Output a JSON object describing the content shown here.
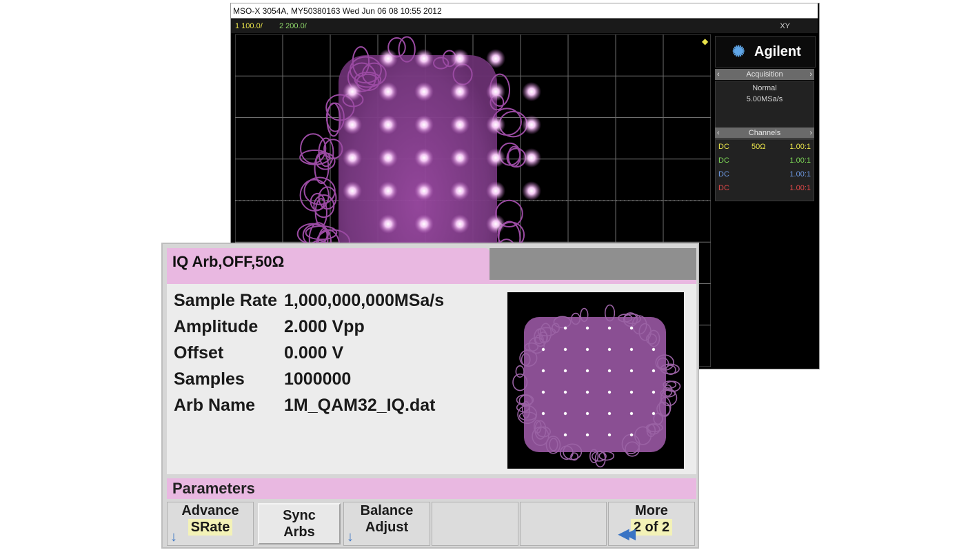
{
  "scope": {
    "title_bar": "MSO-X 3054A, MY50380163 Wed Jun 06 08 10:55 2012",
    "ch1_scale": "1  100.0/",
    "ch2_scale": "2  200.0/",
    "mode": "XY",
    "brand": "Agilent",
    "acquisition": {
      "header": "Acquisition",
      "mode": "Normal",
      "rate": "5.00MSa/s"
    },
    "channels": {
      "header": "Channels",
      "rows": [
        {
          "coupling": "DC",
          "impedance": "50Ω",
          "probe": "1.00:1",
          "color": "#e9e34a"
        },
        {
          "coupling": "DC",
          "impedance": "",
          "probe": "1.00:1",
          "color": "#7ed957"
        },
        {
          "coupling": "DC",
          "impedance": "",
          "probe": "1.00:1",
          "color": "#6f9be6"
        },
        {
          "coupling": "DC",
          "impedance": "",
          "probe": "1.00:1",
          "color": "#e04848"
        }
      ]
    }
  },
  "generator": {
    "tab_label": "IQ Arb,OFF,50Ω",
    "params": [
      {
        "label": "Sample Rate",
        "value": "1,000,000,000MSa/s"
      },
      {
        "label": "Amplitude",
        "value": "2.000 Vpp"
      },
      {
        "label": "Offset",
        "value": "0.000 V"
      },
      {
        "label": "Samples",
        "value": "1000000"
      },
      {
        "label": "Arb Name",
        "value": "1M_QAM32_IQ.dat"
      }
    ],
    "section_label": "Parameters",
    "softkeys": {
      "advance_top": "Advance",
      "advance_bottom": "SRate",
      "sync_top": "Sync",
      "sync_bottom": "Arbs",
      "balance_top": "Balance",
      "balance_bottom": "Adjust",
      "more_top": "More",
      "more_bottom": "2 of 2"
    }
  },
  "colors": {
    "constellation": "#b260b8",
    "tab_pink": "#e9b8e1",
    "softkey_highlight": "#f3f2b7"
  }
}
